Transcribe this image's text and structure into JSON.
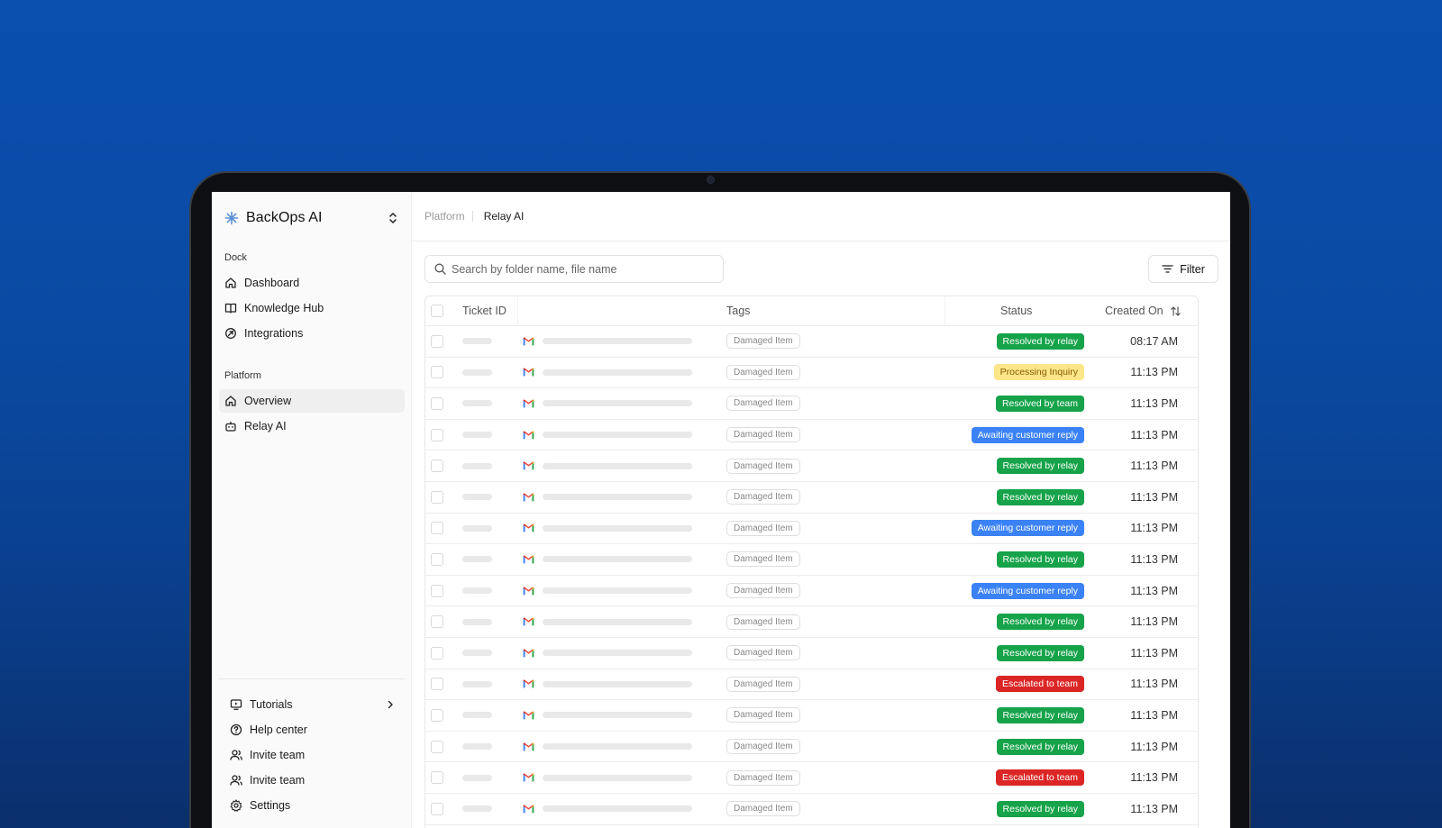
{
  "app": {
    "brand_name": "BackOps AI"
  },
  "sidebar": {
    "sections": [
      {
        "label": "Dock",
        "items": [
          {
            "label": "Dashboard",
            "icon": "home-icon"
          },
          {
            "label": "Knowledge Hub",
            "icon": "book-icon"
          },
          {
            "label": "Integrations",
            "icon": "integrations-icon"
          }
        ]
      },
      {
        "label": "Platform",
        "items": [
          {
            "label": "Overview",
            "icon": "home-icon",
            "active": true
          },
          {
            "label": "Relay AI",
            "icon": "bot-icon"
          }
        ]
      }
    ],
    "footer_items": [
      {
        "label": "Tutorials",
        "icon": "monitor-icon",
        "has_chevron": true
      },
      {
        "label": "Help center",
        "icon": "help-icon"
      },
      {
        "label": "Invite team",
        "icon": "users-icon"
      },
      {
        "label": "Invite team",
        "icon": "users-icon"
      },
      {
        "label": "Settings",
        "icon": "gear-icon"
      }
    ]
  },
  "breadcrumb": {
    "items": [
      "Platform",
      "Relay AI"
    ]
  },
  "search": {
    "placeholder": "Search by folder name, file name",
    "value": ""
  },
  "toolbar": {
    "filter_label": "Filter"
  },
  "table": {
    "columns": [
      "Ticket ID",
      "Tags",
      "Status",
      "Created On"
    ],
    "rows": [
      {
        "tag": "Damaged Item",
        "status": "Resolved by relay",
        "status_type": "relay",
        "created": "08:17 AM"
      },
      {
        "tag": "Damaged Item",
        "status": "Processing Inquiry",
        "status_type": "processing",
        "created": "11:13 PM"
      },
      {
        "tag": "Damaged Item",
        "status": "Resolved by team",
        "status_type": "team",
        "created": "11:13 PM"
      },
      {
        "tag": "Damaged Item",
        "status": "Awaiting customer reply",
        "status_type": "awaiting",
        "created": "11:13 PM"
      },
      {
        "tag": "Damaged Item",
        "status": "Resolved by relay",
        "status_type": "relay",
        "created": "11:13 PM"
      },
      {
        "tag": "Damaged Item",
        "status": "Resolved by relay",
        "status_type": "relay",
        "created": "11:13 PM"
      },
      {
        "tag": "Damaged Item",
        "status": "Awaiting customer reply",
        "status_type": "awaiting",
        "created": "11:13 PM"
      },
      {
        "tag": "Damaged Item",
        "status": "Resolved by relay",
        "status_type": "relay",
        "created": "11:13 PM"
      },
      {
        "tag": "Damaged Item",
        "status": "Awaiting customer reply",
        "status_type": "awaiting",
        "created": "11:13 PM"
      },
      {
        "tag": "Damaged Item",
        "status": "Resolved by relay",
        "status_type": "relay",
        "created": "11:13 PM"
      },
      {
        "tag": "Damaged Item",
        "status": "Resolved by relay",
        "status_type": "relay",
        "created": "11:13 PM"
      },
      {
        "tag": "Damaged Item",
        "status": "Escalated to team",
        "status_type": "escalated",
        "created": "11:13 PM"
      },
      {
        "tag": "Damaged Item",
        "status": "Resolved by relay",
        "status_type": "relay",
        "created": "11:13 PM"
      },
      {
        "tag": "Damaged Item",
        "status": "Resolved by relay",
        "status_type": "relay",
        "created": "11:13 PM"
      },
      {
        "tag": "Damaged Item",
        "status": "Escalated to team",
        "status_type": "escalated",
        "created": "11:13 PM"
      },
      {
        "tag": "Damaged Item",
        "status": "Resolved by relay",
        "status_type": "relay",
        "created": "11:13 PM"
      }
    ]
  },
  "colors": {
    "background_top": "#0a4fae",
    "background_bottom": "#0b2f6c",
    "status_relay": "#16a34a",
    "status_team": "#16a34a",
    "status_processing": "#fde68a",
    "status_awaiting": "#3b82f6",
    "status_escalated": "#dc2626"
  }
}
